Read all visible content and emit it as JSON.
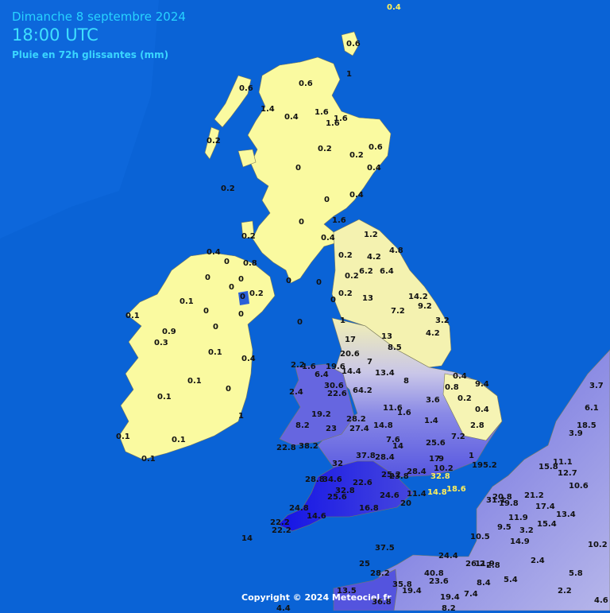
{
  "header": {
    "date": "Dimanche 8 septembre 2024",
    "time": "18:00 UTC",
    "subtitle": "Pluie en 72h glissantes (mm)"
  },
  "footer": {
    "copyright": "Copyright © 2024 Meteociel.fr"
  },
  "colors": {
    "sea": "#0a63d6",
    "land_dry": "#fafaa0",
    "rain_light": "#b8b8e6",
    "rain_moderate": "#7a7ae0",
    "rain_heavy": "#3a3ad8",
    "rain_very_heavy": "#1010e6",
    "value_text_dark": "#111111",
    "value_text_light": "#ffef5a"
  },
  "values": [
    {
      "v": "0.4"
    },
    {
      "v": "0.6"
    },
    {
      "v": "1"
    },
    {
      "v": "0.6"
    },
    {
      "v": "0.6"
    },
    {
      "v": "1.4"
    },
    {
      "v": "0.4"
    },
    {
      "v": "1.6"
    },
    {
      "v": "1.6"
    },
    {
      "v": "1.6"
    },
    {
      "v": "0.2"
    },
    {
      "v": "0.2"
    },
    {
      "v": "0.2"
    },
    {
      "v": "0.6"
    },
    {
      "v": "0"
    },
    {
      "v": "0.4"
    },
    {
      "v": "0.2"
    },
    {
      "v": "0.4"
    },
    {
      "v": "0"
    },
    {
      "v": "0.2"
    },
    {
      "v": "1.6"
    },
    {
      "v": "0"
    },
    {
      "v": "0.2"
    },
    {
      "v": "0.4"
    },
    {
      "v": "1.2"
    },
    {
      "v": "0"
    },
    {
      "v": "0.4"
    },
    {
      "v": "0.8"
    },
    {
      "v": "4.8"
    },
    {
      "v": "0.2"
    },
    {
      "v": "4.2"
    },
    {
      "v": "6.2"
    },
    {
      "v": "6.4"
    },
    {
      "v": "0.2"
    },
    {
      "v": "0"
    },
    {
      "v": "0"
    },
    {
      "v": "0"
    },
    {
      "v": "0"
    },
    {
      "v": "0"
    },
    {
      "v": "0.1"
    },
    {
      "v": "0.2"
    },
    {
      "v": "13"
    },
    {
      "v": "14.2"
    },
    {
      "v": "0"
    },
    {
      "v": "0"
    },
    {
      "v": "1"
    },
    {
      "v": "7.2"
    },
    {
      "v": "9.2"
    },
    {
      "v": "0.1"
    },
    {
      "v": "0"
    },
    {
      "v": "0"
    },
    {
      "v": "3.2"
    },
    {
      "v": "0.9"
    },
    {
      "v": "0"
    },
    {
      "v": "0.3"
    },
    {
      "v": "17"
    },
    {
      "v": "13"
    },
    {
      "v": "4.2"
    },
    {
      "v": "8.5"
    },
    {
      "v": "0.1"
    },
    {
      "v": "20.6"
    },
    {
      "v": "2.2"
    },
    {
      "v": "1.6"
    },
    {
      "v": "19.6"
    },
    {
      "v": "7"
    },
    {
      "v": "0"
    },
    {
      "v": "6.4"
    },
    {
      "v": "14.4"
    },
    {
      "v": "13.4"
    },
    {
      "v": "0.4"
    },
    {
      "v": "0.4"
    },
    {
      "v": "0.1"
    },
    {
      "v": "30.6"
    },
    {
      "v": "8"
    },
    {
      "v": "0.8"
    },
    {
      "v": "9.4"
    },
    {
      "v": "2.4"
    },
    {
      "v": "22.6"
    },
    {
      "v": "64.2"
    },
    {
      "v": "0"
    },
    {
      "v": "3.6"
    },
    {
      "v": "0.2"
    },
    {
      "v": "0.1"
    },
    {
      "v": "11.6"
    },
    {
      "v": "1.6"
    },
    {
      "v": "0.4"
    },
    {
      "v": "19.2"
    },
    {
      "v": "28.2"
    },
    {
      "v": "1.4"
    },
    {
      "v": "1"
    },
    {
      "v": "8.2"
    },
    {
      "v": "23"
    },
    {
      "v": "27.4"
    },
    {
      "v": "14.8"
    },
    {
      "v": "2.8"
    },
    {
      "v": "0.1"
    },
    {
      "v": "7.6"
    },
    {
      "v": "7.2"
    },
    {
      "v": "0.1"
    },
    {
      "v": "22.8"
    },
    {
      "v": "38.2"
    },
    {
      "v": "14"
    },
    {
      "v": "25.6"
    },
    {
      "v": "17"
    },
    {
      "v": "9"
    },
    {
      "v": "0.1"
    },
    {
      "v": "37.8"
    },
    {
      "v": "28.4"
    },
    {
      "v": "1"
    },
    {
      "v": "32"
    },
    {
      "v": "10.2"
    },
    {
      "v": "19"
    },
    {
      "v": "5.2"
    },
    {
      "v": "25.2"
    },
    {
      "v": "23.8"
    },
    {
      "v": "28.4"
    },
    {
      "v": "32.8"
    },
    {
      "v": "28.8"
    },
    {
      "v": "34.6"
    },
    {
      "v": "22.6"
    },
    {
      "v": "18.6"
    },
    {
      "v": "32.8"
    },
    {
      "v": "25.6"
    },
    {
      "v": "24.6"
    },
    {
      "v": "11.4"
    },
    {
      "v": "14.8"
    },
    {
      "v": "20"
    },
    {
      "v": "16.8"
    },
    {
      "v": "24.8"
    },
    {
      "v": "14.6"
    },
    {
      "v": "22.2"
    },
    {
      "v": "22.2"
    },
    {
      "v": "14"
    },
    {
      "v": "37.5"
    },
    {
      "v": "25"
    },
    {
      "v": "28.2"
    },
    {
      "v": "35.8"
    },
    {
      "v": "19.4"
    },
    {
      "v": "40.8"
    },
    {
      "v": "23.6"
    },
    {
      "v": "19.4"
    },
    {
      "v": "7.4"
    },
    {
      "v": "8.4"
    },
    {
      "v": "10.5"
    },
    {
      "v": "9.5"
    },
    {
      "v": "3.2"
    },
    {
      "v": "14.9"
    },
    {
      "v": "11.9"
    },
    {
      "v": "15.4"
    },
    {
      "v": "10.2"
    },
    {
      "v": "5.8"
    },
    {
      "v": "2.2"
    },
    {
      "v": "4.6"
    },
    {
      "v": "3.7"
    },
    {
      "v": "6.1"
    },
    {
      "v": "3.9"
    },
    {
      "v": "18.5"
    },
    {
      "v": "11.1"
    },
    {
      "v": "15.8"
    },
    {
      "v": "12.7"
    },
    {
      "v": "21.2"
    },
    {
      "v": "17.4"
    },
    {
      "v": "13.4"
    },
    {
      "v": "20.8"
    },
    {
      "v": "24.4"
    },
    {
      "v": "26.2"
    },
    {
      "v": "11.9"
    },
    {
      "v": "2.4"
    },
    {
      "v": "5.4"
    },
    {
      "v": "2.8"
    },
    {
      "v": "13.5"
    },
    {
      "v": "36.8"
    },
    {
      "v": "8.2"
    },
    {
      "v": "4.4"
    },
    {
      "v": "31.1"
    },
    {
      "v": "19.8"
    },
    {
      "v": "10.6"
    }
  ]
}
